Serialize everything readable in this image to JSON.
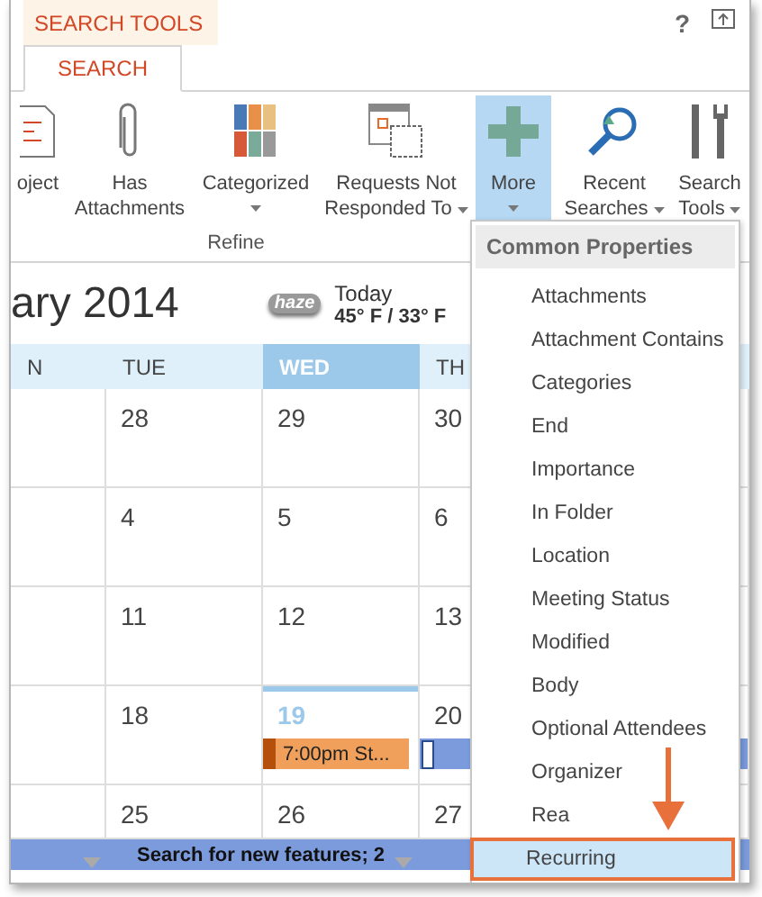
{
  "context_tab": "SEARCH TOOLS",
  "help": "?",
  "tabs": [
    {
      "label": "SEARCH",
      "selected": true
    }
  ],
  "ribbon": {
    "group_label": "Refine",
    "buttons": [
      {
        "label": "oject",
        "dropdown": false,
        "selected": false
      },
      {
        "label": "Has\nAttachments",
        "dropdown": false,
        "selected": false
      },
      {
        "label": "Categorized",
        "dropdown": true,
        "selected": false
      },
      {
        "label": "Requests Not\nResponded To",
        "dropdown": true,
        "selected": false
      },
      {
        "label": "More",
        "dropdown": true,
        "selected": true
      },
      {
        "label": "Recent\nSearches",
        "dropdown": true,
        "selected": false
      },
      {
        "label": "Search\nTools",
        "dropdown": true,
        "selected": false
      }
    ]
  },
  "calendar": {
    "month_title": "ary 2014",
    "weather": {
      "badge": "haze",
      "label": "Today",
      "temps": "45° F / 33° F"
    },
    "days": [
      {
        "label": "N",
        "selected": false
      },
      {
        "label": "TUE",
        "selected": false
      },
      {
        "label": "WED",
        "selected": true
      },
      {
        "label": "TH",
        "selected": false
      }
    ],
    "weeks": [
      [
        {
          "date": "28"
        },
        {
          "date": "29"
        },
        {
          "date": "30"
        }
      ],
      [
        {
          "date": "4"
        },
        {
          "date": "5"
        },
        {
          "date": "6"
        }
      ],
      [
        {
          "date": "11"
        },
        {
          "date": "12"
        },
        {
          "date": "13"
        }
      ],
      [
        {
          "date": "18"
        },
        {
          "date": "19",
          "today": true,
          "events": [
            {
              "kind": "labeled",
              "text": "7:00pm St..."
            }
          ]
        },
        {
          "date": "20",
          "events": [
            {
              "kind": "bar"
            }
          ]
        }
      ],
      [
        {
          "date": "25"
        },
        {
          "date": "26"
        },
        {
          "date": "27"
        }
      ]
    ]
  },
  "status_bar": "Search for new features; 2",
  "menu": {
    "header": "Common Properties",
    "items": [
      {
        "label": "Attachments",
        "selected": false
      },
      {
        "label": "Attachment Contains",
        "selected": false
      },
      {
        "label": "Categories",
        "selected": false
      },
      {
        "label": "End",
        "selected": false
      },
      {
        "label": "Importance",
        "selected": false
      },
      {
        "label": "In Folder",
        "selected": false
      },
      {
        "label": "Location",
        "selected": false
      },
      {
        "label": "Meeting Status",
        "selected": false
      },
      {
        "label": "Modified",
        "selected": false
      },
      {
        "label": "Body",
        "selected": false
      },
      {
        "label": "Optional Attendees",
        "selected": false
      },
      {
        "label": "Organizer",
        "selected": false
      },
      {
        "label": "Rea",
        "selected": false
      },
      {
        "label": "Recurring",
        "selected": true
      }
    ]
  }
}
